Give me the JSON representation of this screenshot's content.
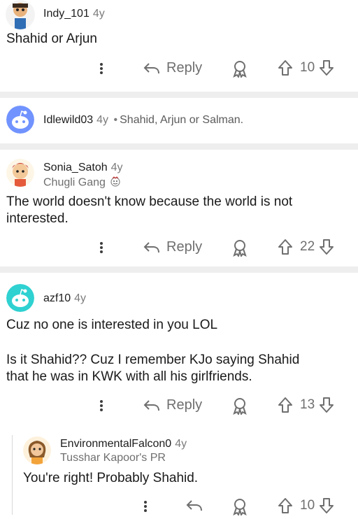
{
  "comments": [
    {
      "user": "Indy_101",
      "age": "4y",
      "body": "Shahid or Arjun",
      "reply_label": "Reply",
      "votes": "10"
    },
    {
      "user": "Idlewild03",
      "age": "4y",
      "separator": "•",
      "preview": "Shahid, Arjun or Salman."
    },
    {
      "user": "Sonia_Satoh",
      "age": "4y",
      "flair": "Chugli Gang",
      "body_lines": [
        "The world doesn't know because the world is not",
        "interested."
      ],
      "reply_label": "Reply",
      "votes": "22"
    },
    {
      "user": "azf10",
      "age": "4y",
      "body_lines": [
        "Cuz no one is interested in you LOL",
        "",
        "Is it Shahid?? Cuz I remember KJo saying Shahid",
        "that he was in KWK  with all his girlfriends."
      ],
      "reply_label": "Reply",
      "votes": "13"
    },
    {
      "user": "EnvironmentalFalcon0",
      "age": "4y",
      "flair": "Tusshar Kapoor's PR",
      "body": "You're right! Probably Shahid.",
      "votes": "10"
    }
  ],
  "colors": {
    "separator": "#eeeeee",
    "meta": "#7c7c7c",
    "icon": "#6f6f6f"
  }
}
